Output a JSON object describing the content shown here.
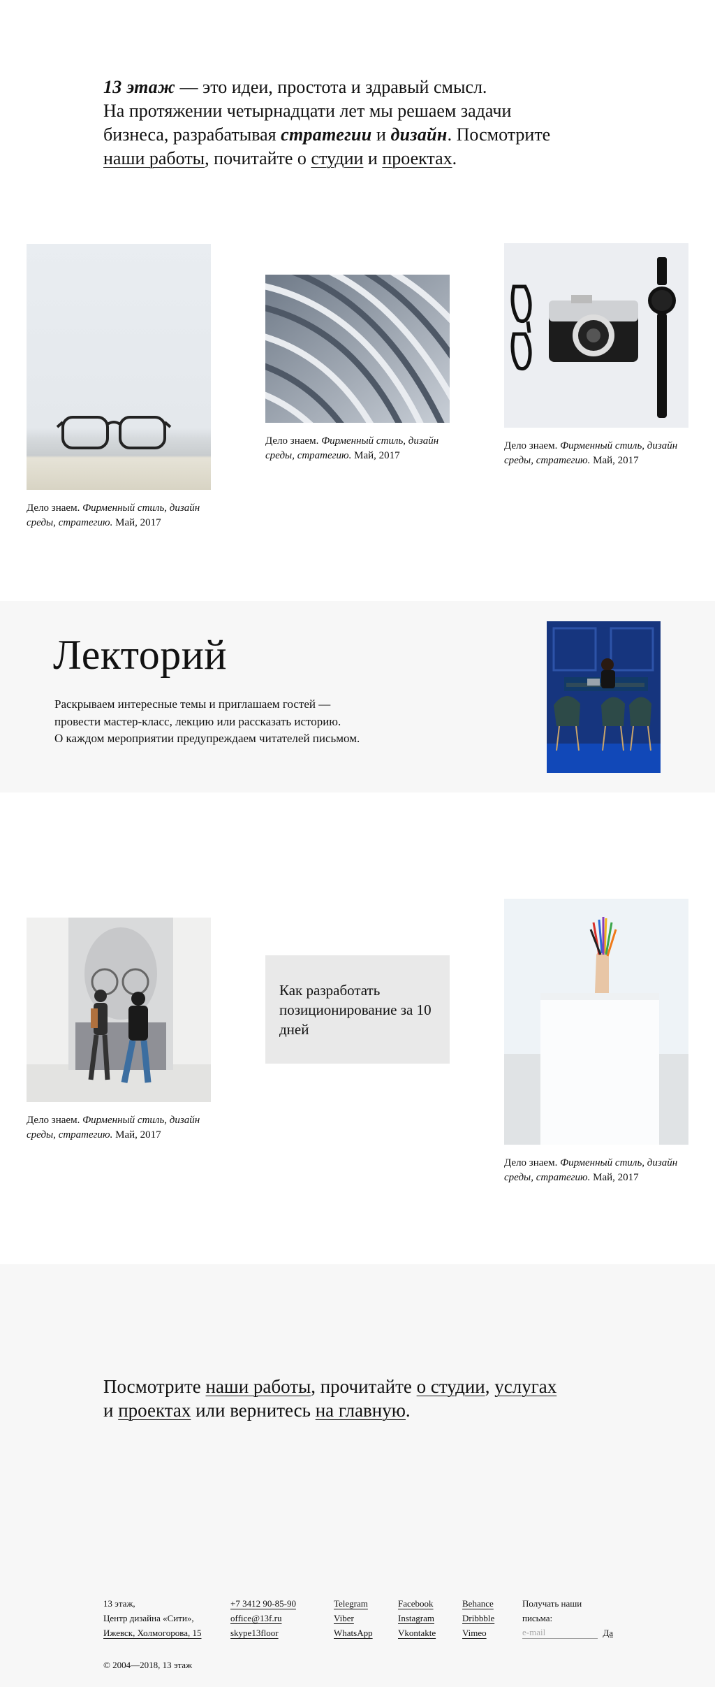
{
  "intro": {
    "brand": "13 этаж",
    "line1_rest": " — это идеи, простота и здравый смысл.",
    "line2": "На протяжении четырнадцати лет мы решаем задачи",
    "line3_a": "бизнеса, разрабатывая ",
    "strategy": "стратегии",
    "and": " и ",
    "design": "дизайн",
    "line3_b": ". Посмотрите",
    "works_link": "наши работы",
    "line4_a": ", почитайте о ",
    "studio_link": "студии",
    "line4_b": " и ",
    "projects_link": "проектах",
    "line4_c": "."
  },
  "cards": [
    {
      "lead": "Дело знаем. ",
      "italic": "Фирменный стиль, дизайн среды, стратегию.",
      "date": " Май, 2017",
      "image": "glasses-photo"
    },
    {
      "lead": "Дело знаем. ",
      "italic": "Фирменный стиль, дизайн среды, стратегию.",
      "date": " Май, 2017",
      "image": "architecture-curves-photo"
    },
    {
      "lead": "Дело знаем. ",
      "italic": "Фирменный стиль, дизайн среды, стратегию.",
      "date": " Май, 2017",
      "image": "camera-glasses-watch-photo"
    }
  ],
  "lectorium": {
    "title": "Лекторий",
    "desc1": "Раскрываем интересные темы и приглашаем гостей —",
    "desc2": "провести мастер-класс, лекцию или рассказать историю.",
    "desc3": "О каждом мероприятии предупреждаем читателей письмом."
  },
  "cards2": [
    {
      "lead": "Дело знаем. ",
      "italic": "Фирменный стиль, дизайн среды, стратегию.",
      "date": " Май, 2017",
      "image": "gallery-visitors-photo"
    },
    {
      "text": "Как разработать позиционирование за 10 дней"
    },
    {
      "lead": "Дело знаем. ",
      "italic": "Фирменный стиль, дизайн среды, стратегию.",
      "date": " Май, 2017",
      "image": "pencils-hand-photo"
    }
  ],
  "bottom": {
    "a": "Посмотрите ",
    "works": "наши работы",
    "b": ", прочитайте ",
    "studio": "о студии",
    "c": ", ",
    "services": "услугах",
    "d": "и ",
    "projects": "проектах",
    "e": " или вернитесь ",
    "home": "на главную",
    "f": "."
  },
  "footer": {
    "address": [
      "13 этаж,",
      "Центр дизайна «Сити»,",
      "Ижевск, Холмогорова, 15"
    ],
    "phone": "+7 3412 90-85-90",
    "email": "office@13f.ru",
    "skype": "skype13floor",
    "social1": [
      "Telegram",
      "Viber",
      "WhatsApp"
    ],
    "social2": [
      "Facebook",
      "Instagram",
      "Vkontakte"
    ],
    "social3": [
      "Behance",
      "Dribbble",
      "Vimeo"
    ],
    "newsletter_label": "Получать наши письма:",
    "newsletter_placeholder": "e-mail",
    "newsletter_button": "Да",
    "copyright": "© 2004—2018, 13 этаж"
  }
}
